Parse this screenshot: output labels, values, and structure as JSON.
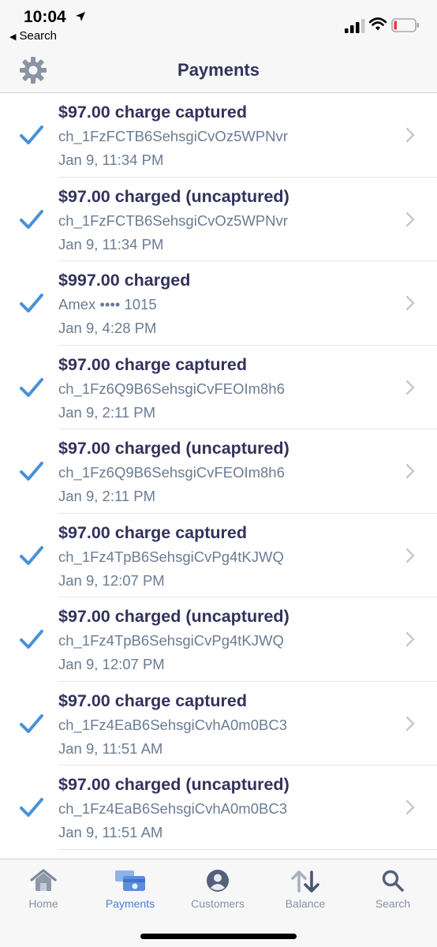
{
  "status_bar": {
    "time": "10:04",
    "back_app": "Search"
  },
  "nav": {
    "title": "Payments"
  },
  "payments": [
    {
      "title": "$97.00 charge captured",
      "subtitle": "ch_1FzFCTB6SehsgiCvOz5WPNvr",
      "date": "Jan 9, 11:34 PM"
    },
    {
      "title": "$97.00 charged (uncaptured)",
      "subtitle": "ch_1FzFCTB6SehsgiCvOz5WPNvr",
      "date": "Jan 9, 11:34 PM"
    },
    {
      "title": "$997.00 charged",
      "subtitle": "Amex •••• 1015",
      "date": "Jan 9, 4:28 PM"
    },
    {
      "title": "$97.00 charge captured",
      "subtitle": "ch_1Fz6Q9B6SehsgiCvFEOIm8h6",
      "date": "Jan 9, 2:11 PM"
    },
    {
      "title": "$97.00 charged (uncaptured)",
      "subtitle": "ch_1Fz6Q9B6SehsgiCvFEOIm8h6",
      "date": "Jan 9, 2:11 PM"
    },
    {
      "title": "$97.00 charge captured",
      "subtitle": "ch_1Fz4TpB6SehsgiCvPg4tKJWQ",
      "date": "Jan 9, 12:07 PM"
    },
    {
      "title": "$97.00 charged (uncaptured)",
      "subtitle": "ch_1Fz4TpB6SehsgiCvPg4tKJWQ",
      "date": "Jan 9, 12:07 PM"
    },
    {
      "title": "$97.00 charge captured",
      "subtitle": "ch_1Fz4EaB6SehsgiCvhA0m0BC3",
      "date": "Jan 9, 11:51 AM"
    },
    {
      "title": "$97.00 charged (uncaptured)",
      "subtitle": "ch_1Fz4EaB6SehsgiCvhA0m0BC3",
      "date": "Jan 9, 11:51 AM"
    }
  ],
  "tabs": [
    {
      "label": "Home",
      "icon": "home-icon",
      "active": false
    },
    {
      "label": "Payments",
      "icon": "payments-icon",
      "active": true
    },
    {
      "label": "Customers",
      "icon": "customer-icon",
      "active": false
    },
    {
      "label": "Balance",
      "icon": "balance-icon",
      "active": false
    },
    {
      "label": "Search",
      "icon": "search-icon",
      "active": false
    }
  ],
  "colors": {
    "accent": "#4a7fd6",
    "check": "#4a90d9",
    "title_text": "#32325d",
    "secondary_text": "#6b7c93",
    "battery_low": "#e23b3b"
  }
}
